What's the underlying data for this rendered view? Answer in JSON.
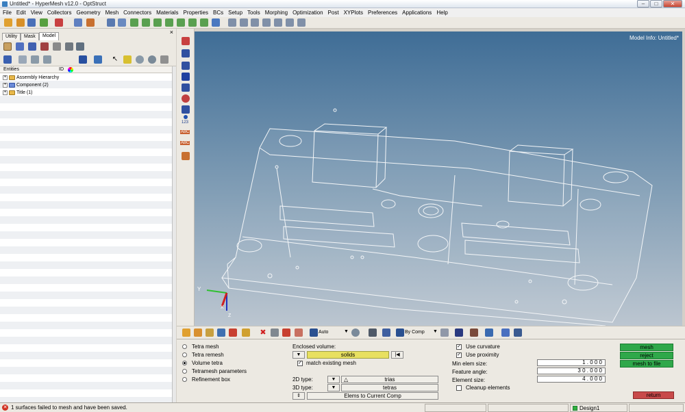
{
  "window": {
    "title": "Untitled* - HyperMesh v12.0 - OptStruct",
    "minimize": "–",
    "maximize": "□",
    "close": "✕"
  },
  "menu": [
    "File",
    "Edit",
    "View",
    "Collectors",
    "Geometry",
    "Mesh",
    "Connectors",
    "Materials",
    "Properties",
    "BCs",
    "Setup",
    "Tools",
    "Morphing",
    "Optimization",
    "Post",
    "XYPlots",
    "Preferences",
    "Applications",
    "Help"
  ],
  "left_pane": {
    "tabs": [
      "Utility",
      "Mask",
      "Model"
    ],
    "close": "×",
    "col_entities": "Entities",
    "col_id": "ID",
    "tree": [
      {
        "label": "Assembly Hierarchy",
        "expander": "+"
      },
      {
        "label": "Component (2)",
        "expander": "+"
      },
      {
        "label": "Title (1)",
        "expander": "+"
      }
    ]
  },
  "viewport": {
    "model_info": "Model Info: Untitled*",
    "axis_x": "X",
    "axis_y": "Y",
    "axis_z": "Z"
  },
  "vtool": {
    "label_123": "123",
    "label_abc1": "ABC",
    "label_abc2": "ABC"
  },
  "toolbar2": {
    "auto_select": "Auto",
    "by_comp_select": "By Comp"
  },
  "panel": {
    "radios": [
      {
        "label": "Tetra mesh",
        "checked": false
      },
      {
        "label": "Tetra remesh",
        "checked": false
      },
      {
        "label": "Volume tetra",
        "checked": true
      },
      {
        "label": "Tetramesh parameters",
        "checked": false
      },
      {
        "label": "Refinement box",
        "checked": false
      }
    ],
    "enclosed_volume_label": "Enclosed volume:",
    "solids_selector": "solids",
    "match_existing_mesh": "match existing mesh",
    "type2d_label": "2D type:",
    "type2d_value": "trias",
    "type3d_label": "3D type:",
    "type3d_value": "tetras",
    "elems_to_comp": "Elems to Current Comp",
    "use_curvature": "Use curvature",
    "use_proximity": "Use proximity",
    "min_elem_label": "Min elem size:",
    "min_elem_value": "1 . 0 0 0",
    "feature_angle_label": "Feature angle:",
    "feature_angle_value": "3 0 . 0 0 0",
    "elem_size_label": "Element size:",
    "elem_size_value": "4 . 0 0 0",
    "cleanup_label": "Cleanup elements",
    "btn_mesh": "mesh",
    "btn_reject": "reject",
    "btn_mesh_to_file": "mesh to file",
    "btn_return": "return"
  },
  "status": {
    "message": "1 surfaces failed to mesh and have been saved.",
    "error_glyph": "✕",
    "design": "Design1"
  },
  "colors": {
    "green_button": "#2fa84a",
    "return_button": "#c84a4a",
    "solids_highlight": "#e8e060"
  }
}
